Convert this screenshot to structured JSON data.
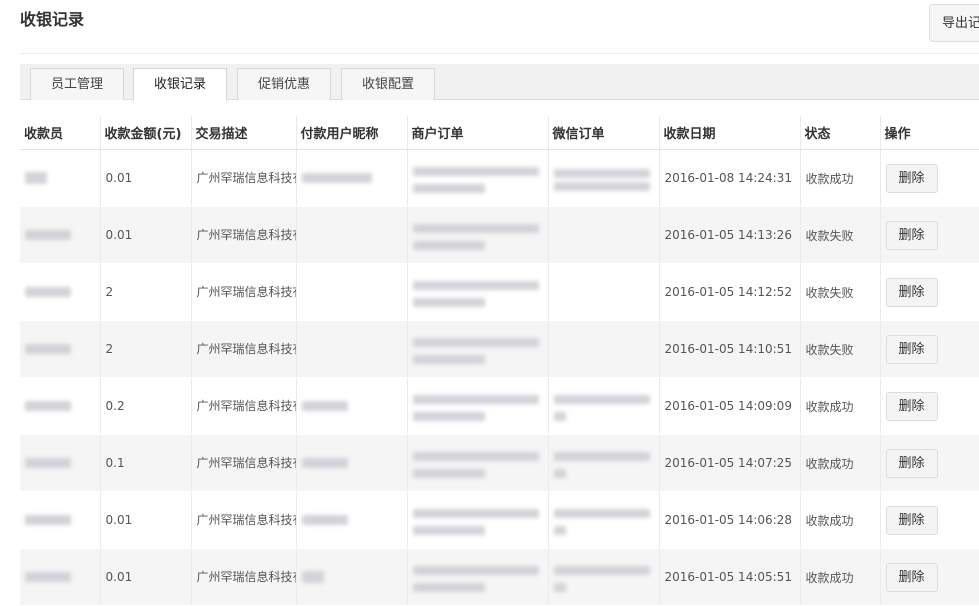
{
  "page": {
    "title": "收银记录",
    "export_label": "导出记录"
  },
  "tabs": [
    {
      "label": "员工管理",
      "active": false
    },
    {
      "label": "收银记录",
      "active": true
    },
    {
      "label": "促销优惠",
      "active": false
    },
    {
      "label": "收银配置",
      "active": false
    }
  ],
  "table": {
    "columns": [
      "收款员",
      "收款金额(元)",
      "交易描述",
      "付款用户昵称",
      "商户订单",
      "微信订单",
      "收款日期",
      "状态",
      "操作"
    ],
    "delete_label": "删除",
    "rows": [
      {
        "amount": "0.01",
        "desc": "广州罕瑞信息科技有限公司",
        "date": "2016-01-08 14:24:31",
        "status": "收款成功"
      },
      {
        "amount": "0.01",
        "desc": "广州罕瑞信息科技有限公司",
        "date": "2016-01-05 14:13:26",
        "status": "收款失败"
      },
      {
        "amount": "2",
        "desc": "广州罕瑞信息科技有限公司",
        "date": "2016-01-05 14:12:52",
        "status": "收款失败"
      },
      {
        "amount": "2",
        "desc": "广州罕瑞信息科技有限公司",
        "date": "2016-01-05 14:10:51",
        "status": "收款失败"
      },
      {
        "amount": "0.2",
        "desc": "广州罕瑞信息科技有限公司",
        "date": "2016-01-05 14:09:09",
        "status": "收款成功"
      },
      {
        "amount": "0.1",
        "desc": "广州罕瑞信息科技有限公司",
        "date": "2016-01-05 14:07:25",
        "status": "收款成功"
      },
      {
        "amount": "0.01",
        "desc": "广州罕瑞信息科技有限公司",
        "date": "2016-01-05 14:06:28",
        "status": "收款成功"
      },
      {
        "amount": "0.01",
        "desc": "广州罕瑞信息科技有限公司",
        "date": "2016-01-05 14:05:51",
        "status": "收款成功"
      }
    ]
  }
}
